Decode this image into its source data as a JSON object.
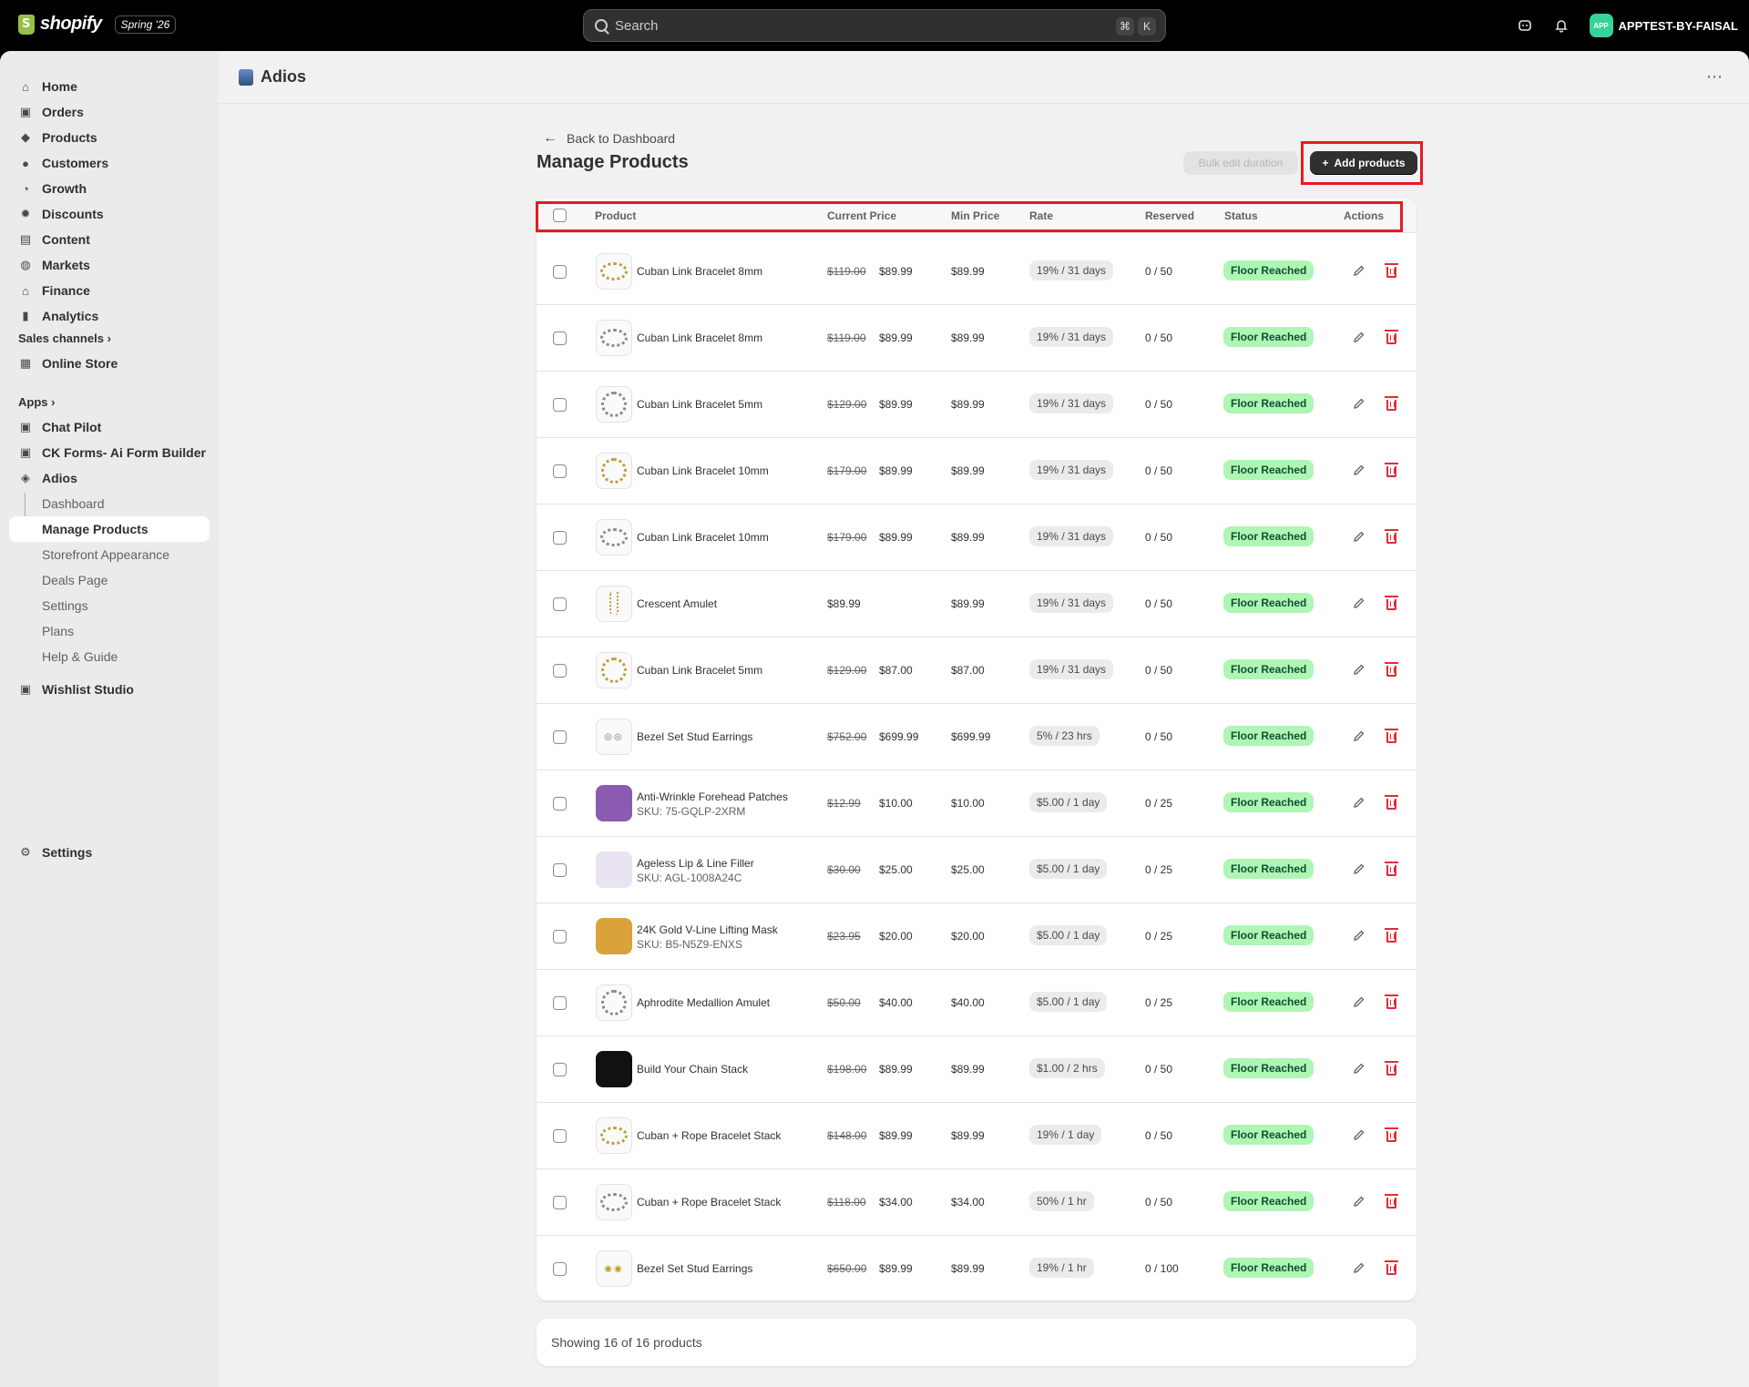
{
  "topbar": {
    "brand": "shopify",
    "edition": "Spring '26",
    "search_placeholder": "Search",
    "shortcut_1": "⌘",
    "shortcut_2": "K",
    "store_name": "APPTEST-BY-FAISAL",
    "store_avatar": "APP"
  },
  "sidebar": {
    "main": [
      {
        "label": "Home",
        "icon": "home-icon"
      },
      {
        "label": "Orders",
        "icon": "orders-icon"
      },
      {
        "label": "Products",
        "icon": "tag-icon"
      },
      {
        "label": "Customers",
        "icon": "person-icon"
      },
      {
        "label": "Growth",
        "icon": "gauge-icon"
      },
      {
        "label": "Discounts",
        "icon": "discount-icon"
      },
      {
        "label": "Content",
        "icon": "content-icon"
      },
      {
        "label": "Markets",
        "icon": "globe-icon"
      },
      {
        "label": "Finance",
        "icon": "bank-icon"
      },
      {
        "label": "Analytics",
        "icon": "chart-icon"
      }
    ],
    "sales_channels_label": "Sales channels",
    "online_store": "Online Store",
    "apps_label": "Apps",
    "apps": [
      "Chat Pilot",
      "CK Forms- Ai Form Builder",
      "Adios"
    ],
    "adios_sub": [
      "Dashboard",
      "Manage Products",
      "Storefront Appearance",
      "Deals Page",
      "Settings",
      "Plans",
      "Help & Guide"
    ],
    "wishlist": "Wishlist Studio",
    "settings": "Settings"
  },
  "header": {
    "app_title": "Adios",
    "more": "⋯"
  },
  "page": {
    "back_label": "Back to Dashboard",
    "title": "Manage Products",
    "bulk_label": "Bulk edit duration",
    "add_label": "Add products"
  },
  "table": {
    "columns": [
      "Product",
      "Current Price",
      "Min Price",
      "Rate",
      "Reserved",
      "Status",
      "Actions"
    ],
    "rows": [
      {
        "name": "Cuban Link Bracelet 8mm",
        "sku": "",
        "old": "$119.00",
        "current": "$89.99",
        "min": "$89.99",
        "rate": "19% / 31 days",
        "reserved": "0 / 50",
        "status": "Floor Reached"
      },
      {
        "name": "Cuban Link Bracelet 8mm",
        "sku": "",
        "old": "$119.00",
        "current": "$89.99",
        "min": "$89.99",
        "rate": "19% / 31 days",
        "reserved": "0 / 50",
        "status": "Floor Reached"
      },
      {
        "name": "Cuban Link Bracelet 5mm",
        "sku": "",
        "old": "$129.00",
        "current": "$89.99",
        "min": "$89.99",
        "rate": "19% / 31 days",
        "reserved": "0 / 50",
        "status": "Floor Reached"
      },
      {
        "name": "Cuban Link Bracelet 10mm",
        "sku": "",
        "old": "$179.00",
        "current": "$89.99",
        "min": "$89.99",
        "rate": "19% / 31 days",
        "reserved": "0 / 50",
        "status": "Floor Reached"
      },
      {
        "name": "Cuban Link Bracelet 10mm",
        "sku": "",
        "old": "$179.00",
        "current": "$89.99",
        "min": "$89.99",
        "rate": "19% / 31 days",
        "reserved": "0 / 50",
        "status": "Floor Reached"
      },
      {
        "name": "Crescent Amulet",
        "sku": "",
        "old": "",
        "current": "$89.99",
        "min": "$89.99",
        "rate": "19% / 31 days",
        "reserved": "0 / 50",
        "status": "Floor Reached"
      },
      {
        "name": "Cuban Link Bracelet 5mm",
        "sku": "",
        "old": "$129.00",
        "current": "$87.00",
        "min": "$87.00",
        "rate": "19% / 31 days",
        "reserved": "0 / 50",
        "status": "Floor Reached"
      },
      {
        "name": "Bezel Set Stud Earrings",
        "sku": "",
        "old": "$752.00",
        "current": "$699.99",
        "min": "$699.99",
        "rate": "5% / 23 hrs",
        "reserved": "0 / 50",
        "status": "Floor Reached"
      },
      {
        "name": "Anti-Wrinkle Forehead Patches",
        "sku": "SKU: 75-GQLP-2XRM",
        "old": "$12.99",
        "current": "$10.00",
        "min": "$10.00",
        "rate": "$5.00 / 1 day",
        "reserved": "0 / 25",
        "status": "Floor Reached"
      },
      {
        "name": "Ageless Lip & Line Filler",
        "sku": "SKU: AGL-1008A24C",
        "old": "$30.00",
        "current": "$25.00",
        "min": "$25.00",
        "rate": "$5.00 / 1 day",
        "reserved": "0 / 25",
        "status": "Floor Reached"
      },
      {
        "name": "24K Gold V-Line Lifting Mask",
        "sku": "SKU: B5-N5Z9-ENXS",
        "old": "$23.95",
        "current": "$20.00",
        "min": "$20.00",
        "rate": "$5.00 / 1 day",
        "reserved": "0 / 25",
        "status": "Floor Reached"
      },
      {
        "name": "Aphrodite Medallion Amulet",
        "sku": "",
        "old": "$50.00",
        "current": "$40.00",
        "min": "$40.00",
        "rate": "$5.00 / 1 day",
        "reserved": "0 / 25",
        "status": "Floor Reached"
      },
      {
        "name": "Build Your Chain Stack",
        "sku": "",
        "old": "$198.00",
        "current": "$89.99",
        "min": "$89.99",
        "rate": "$1.00 / 2 hrs",
        "reserved": "0 / 50",
        "status": "Floor Reached"
      },
      {
        "name": "Cuban + Rope Bracelet Stack",
        "sku": "",
        "old": "$148.00",
        "current": "$89.99",
        "min": "$89.99",
        "rate": "19% / 1 day",
        "reserved": "0 / 50",
        "status": "Floor Reached"
      },
      {
        "name": "Cuban + Rope Bracelet Stack",
        "sku": "",
        "old": "$118.00",
        "current": "$34.00",
        "min": "$34.00",
        "rate": "50% / 1 hr",
        "reserved": "0 / 50",
        "status": "Floor Reached"
      },
      {
        "name": "Bezel Set Stud Earrings",
        "sku": "",
        "old": "$650.00",
        "current": "$89.99",
        "min": "$89.99",
        "rate": "19% / 1 hr",
        "reserved": "0 / 100",
        "status": "Floor Reached"
      }
    ]
  },
  "footer": {
    "showing": "Showing 16 of 16 products"
  },
  "colors": {
    "accent": "#303030",
    "status_bg": "#aff5b4",
    "status_fg": "#0c5132",
    "delete": "#e22c38",
    "highlight": "#e51c23"
  }
}
